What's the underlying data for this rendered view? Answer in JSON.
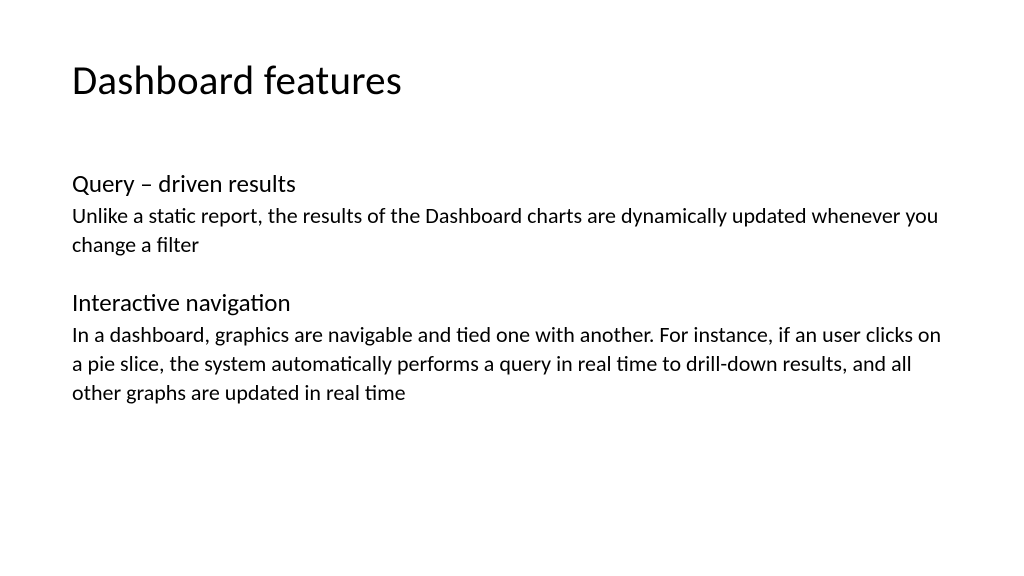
{
  "slide": {
    "title": "Dashboard features",
    "sections": [
      {
        "heading": "Query – driven results",
        "body": "Unlike a static report, the results of the Dashboard charts are dynamically updated whenever you change a filter"
      },
      {
        "heading": "Interactive navigation",
        "body": "In a dashboard, graphics are navigable and tied one with another. For instance, if an user clicks on a pie slice, the system automatically performs a query in real time to drill-down results, and all other graphs are updated in real time"
      }
    ]
  }
}
